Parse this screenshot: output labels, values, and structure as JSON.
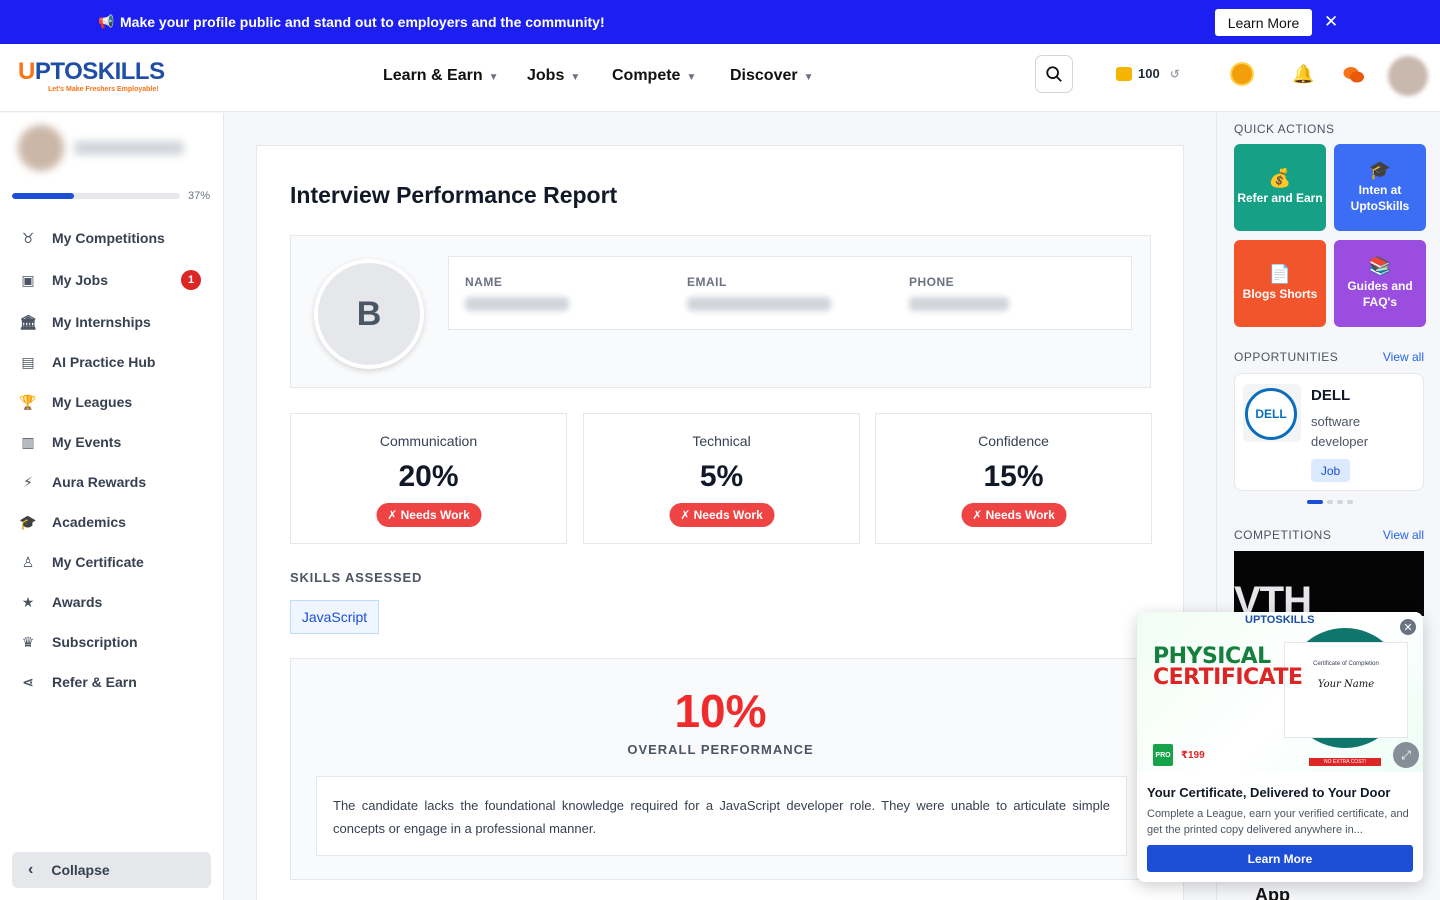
{
  "banner": {
    "text": "Make your profile public and stand out to employers and the community!",
    "cta": "Learn More",
    "close": "✕"
  },
  "logo": {
    "word_u": "U",
    "word_rest": "PTOSKILLS",
    "tagline": "Let's Make Freshers Employable!"
  },
  "nav": {
    "items": [
      "Learn & Earn",
      "Jobs",
      "Compete",
      "Discover"
    ],
    "coins": "100"
  },
  "sidebar": {
    "progress_percent": 37,
    "progress_label": "37%",
    "items": [
      {
        "label": "My Competitions",
        "icon": "medal-icon",
        "glyph": "♉"
      },
      {
        "label": "My Jobs",
        "icon": "briefcase-icon",
        "glyph": "▣",
        "badge": "1"
      },
      {
        "label": "My Internships",
        "icon": "bank-icon",
        "glyph": "🏛"
      },
      {
        "label": "AI Practice Hub",
        "icon": "robot-icon",
        "glyph": "▤"
      },
      {
        "label": "My Leagues",
        "icon": "trophy-icon",
        "glyph": "🏆"
      },
      {
        "label": "My Events",
        "icon": "book-icon",
        "glyph": "▥"
      },
      {
        "label": "Aura Rewards",
        "icon": "bolt-icon",
        "glyph": "⚡"
      },
      {
        "label": "Academics",
        "icon": "graduation-cap-icon",
        "glyph": "🎓"
      },
      {
        "label": "My Certificate",
        "icon": "award-icon",
        "glyph": "♙"
      },
      {
        "label": "Awards",
        "icon": "star-icon",
        "glyph": "★"
      },
      {
        "label": "Subscription",
        "icon": "crown-icon",
        "glyph": "♛"
      },
      {
        "label": "Refer & Earn",
        "icon": "share-icon",
        "glyph": "⋖"
      }
    ],
    "collapse": "Collapse"
  },
  "report": {
    "title": "Interview Performance Report",
    "avatar_letter": "B",
    "fields": {
      "name": "NAME",
      "email": "EMAIL",
      "phone": "PHONE"
    },
    "metrics": [
      {
        "label": "Communication",
        "value": "20%",
        "status": "✗ Needs Work"
      },
      {
        "label": "Technical",
        "value": "5%",
        "status": "✗ Needs Work"
      },
      {
        "label": "Confidence",
        "value": "15%",
        "status": "✗ Needs Work"
      }
    ],
    "skills_heading": "SKILLS ASSESSED",
    "skills": [
      "JavaScript"
    ],
    "overall_value": "10%",
    "overall_label": "OVERALL PERFORMANCE",
    "summary": "The candidate lacks the foundational knowledge required for a JavaScript developer role. They were unable to articulate simple concepts or engage in a professional manner."
  },
  "rail": {
    "quick_actions_heading": "QUICK ACTIONS",
    "quick_actions": [
      {
        "label": "Refer and Earn",
        "color": "#16a085",
        "glyph": "💰"
      },
      {
        "label": "Inten at UptoSkills",
        "color": "#3b6ef5",
        "glyph": "🎓"
      },
      {
        "label": "Blogs Shorts",
        "color": "#f2552c",
        "glyph": "📄"
      },
      {
        "label": "Guides and FAQ's",
        "color": "#9b4de0",
        "glyph": "📚"
      }
    ],
    "opportunities_heading": "OPPORTUNITIES",
    "view_all": "View all",
    "opportunity": {
      "logo": "DELL",
      "company": "DELL",
      "role": "software developer",
      "type": "Job"
    },
    "competitions_heading": "COMPETITIONS",
    "competition_img_text": "VTH",
    "app_peek": "App"
  },
  "popup": {
    "logo": "UPTOSKILLS",
    "headline_1": "PHYSICAL",
    "headline_2": "CERTIFICATE",
    "cert_title": "Certificate of Completion",
    "cert_name": "Your Name",
    "pro": "PRO",
    "price": "₹199",
    "no_extra": "NO EXTRA COST!",
    "title": "Your Certificate, Delivered to Your Door",
    "desc": "Complete a League, earn your verified certificate, and get the printed copy delivered anywhere in...",
    "cta": "Learn More"
  },
  "colors": {
    "brand_blue": "#1d1ff0",
    "danger": "#ef4444",
    "primary": "#1d4ed8"
  }
}
